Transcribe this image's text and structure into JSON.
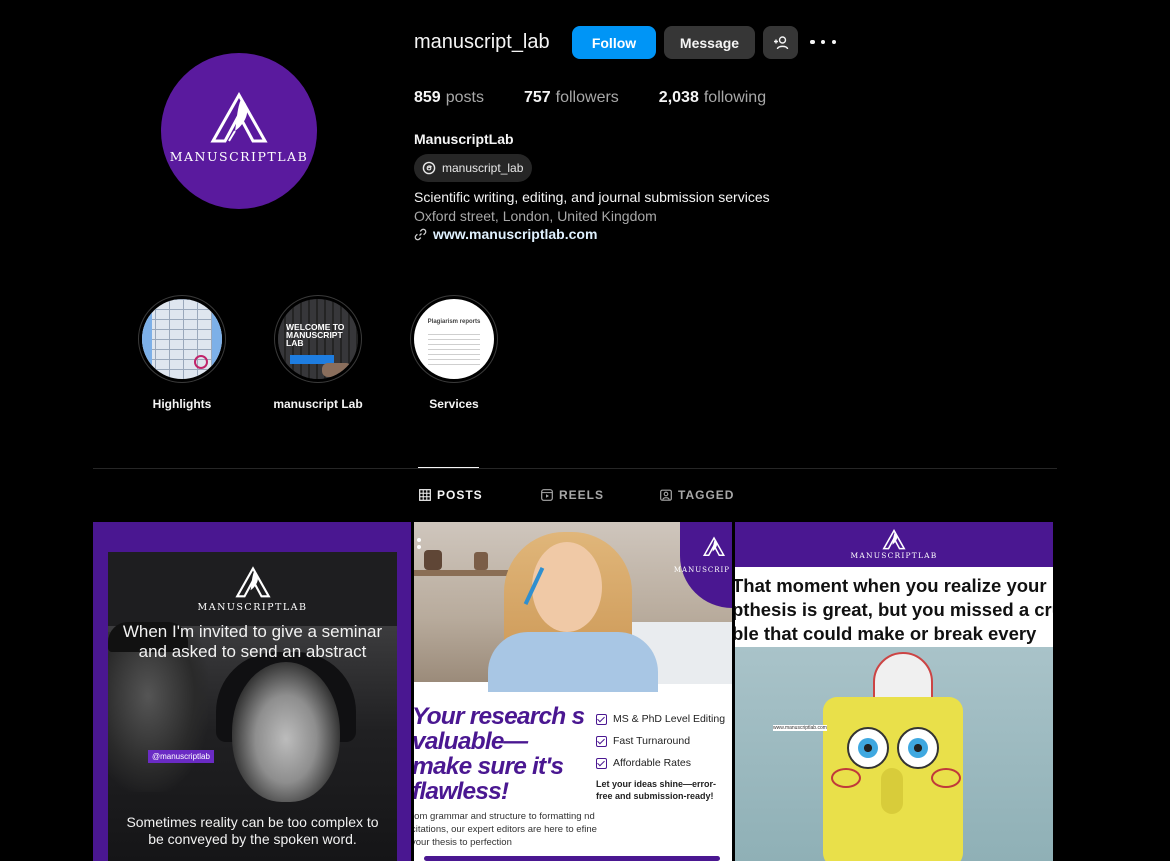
{
  "profile": {
    "username": "manuscript_lab",
    "follow_label": "Follow",
    "message_label": "Message",
    "add_user_icon": "person-plus-icon",
    "more_icon": "more-dots-icon",
    "avatar_wordmark": "MANUSCRIPTLAB",
    "stats": {
      "posts_count": "859",
      "posts_label": "posts",
      "followers_count": "757",
      "followers_label": "followers",
      "following_count": "2,038",
      "following_label": "following"
    },
    "full_name": "ManuscriptLab",
    "threads_handle": "manuscript_lab",
    "bio": "Scientific writing, editing, and journal submission services",
    "location": "Oxford street, London, United Kingdom",
    "website": "www.manuscriptlab.com"
  },
  "highlights": [
    {
      "label": "Highlights"
    },
    {
      "label": "manuscript Lab",
      "thumb_text": "WELCOME TO MANUSCRIPT LAB"
    },
    {
      "label": "Services",
      "thumb_text": "Plagiarism reports"
    }
  ],
  "tabs": [
    {
      "label": "POSTS",
      "icon": "grid-icon",
      "active": true
    },
    {
      "label": "REELS",
      "icon": "reels-icon",
      "active": false
    },
    {
      "label": "TAGGED",
      "icon": "tagged-icon",
      "active": false
    }
  ],
  "posts": [
    {
      "wordmark": "MANUSCRIPTLAB",
      "meme_top": "When I'm invited to give a seminar and asked to send an abstract",
      "tag": "@manuscriptlab",
      "meme_bottom": "Sometimes reality can be too complex to be conveyed by the spoken word."
    },
    {
      "wordmark": "MANUSCRIP",
      "headline": "Your research s valuable— make sure it's flawless!",
      "checks": [
        "MS & PhD Level Editing",
        "Fast Turnaround",
        "Affordable Rates"
      ],
      "cta": "Let your ideas shine—error-free and submission-ready!",
      "body": "rom grammar and structure to formatting nd citations, our expert editors are here to efine your thesis to perfection"
    },
    {
      "wordmark": "MANUSCRIPTLAB",
      "caption_lines": [
        "That moment when you realize your",
        "pthesis is great, but you missed a cru",
        "ble that could make or break every"
      ],
      "note": "www.manuscriptlab.com"
    }
  ],
  "colors": {
    "brand_purple": "#4a1791",
    "follow_blue": "#0095f6",
    "button_gray": "#363636",
    "background": "#000000"
  }
}
